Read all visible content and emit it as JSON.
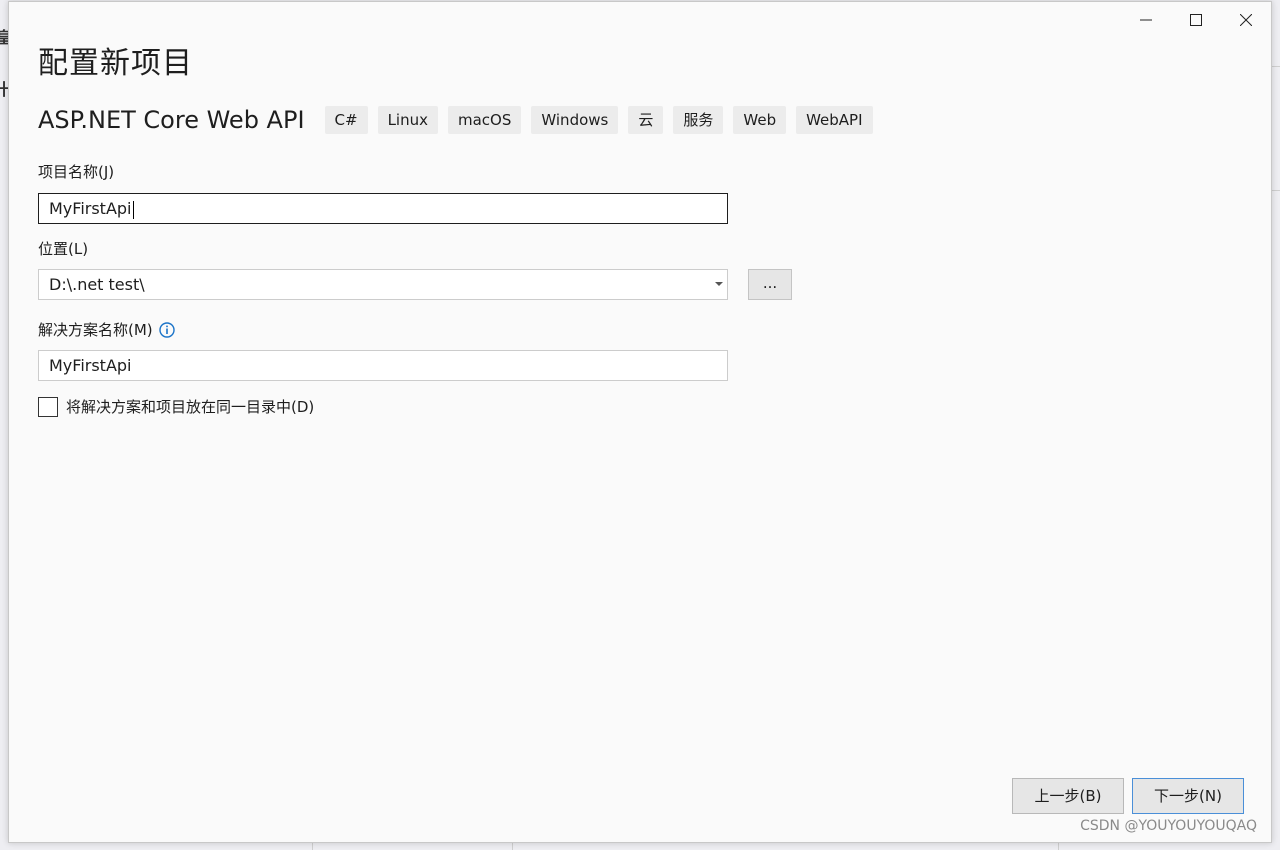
{
  "window": {
    "minimize_label": "Minimize",
    "maximize_label": "Maximize",
    "close_label": "Close"
  },
  "title": "配置新项目",
  "template": {
    "name": "ASP.NET Core Web API",
    "tags": [
      "C#",
      "Linux",
      "macOS",
      "Windows",
      "云",
      "服务",
      "Web",
      "WebAPI"
    ]
  },
  "project_name": {
    "label": "项目名称(J)",
    "value": "MyFirstApi"
  },
  "location": {
    "label": "位置(L)",
    "value": "D:\\.net test\\",
    "browse_label": "..."
  },
  "solution_name": {
    "label": "解决方案名称(M)",
    "value": "MyFirstApi",
    "info_icon": "info-icon"
  },
  "same_directory": {
    "label": "将解决方案和项目放在同一目录中(D)",
    "checked": false
  },
  "buttons": {
    "back": "上一步(B)",
    "next": "下一步(N)"
  },
  "watermark": "CSDN @YOUYOUYOUQAQ",
  "colors": {
    "accent": "#4a8fd8",
    "info": "#1a73c8"
  }
}
